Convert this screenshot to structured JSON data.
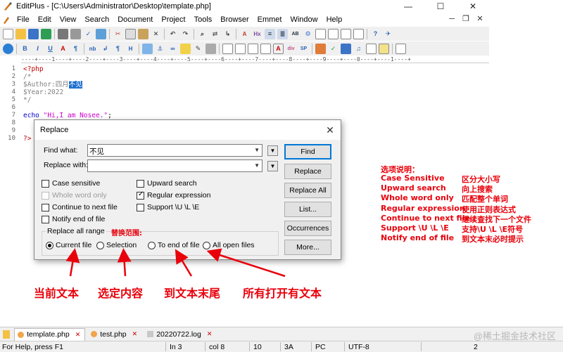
{
  "window": {
    "title": "EditPlus - [C:\\Users\\Administrator\\Desktop\\template.php]",
    "minimize": "—",
    "maximize": "☐",
    "close": "✕"
  },
  "menu": {
    "items": [
      "File",
      "Edit",
      "View",
      "Search",
      "Document",
      "Project",
      "Tools",
      "Browser",
      "Emmet",
      "Window",
      "Help"
    ],
    "right": [
      "─",
      "❐",
      "✕"
    ]
  },
  "ruler": "----+----1----+----2----+----3----+----4----+----5----+----6----+----7----+----8----+----9----+----0----+----1----+",
  "editor": {
    "line_numbers": [
      "1",
      "2",
      "3",
      "4",
      "5",
      "6",
      "7",
      "8",
      "9",
      "10"
    ],
    "lines": {
      "l1": "<?php",
      "l2": "/*",
      "l3_a": "$Author:四月",
      "l3_sel": "不见",
      "l4": "$Year:2022",
      "l5": "*/",
      "l7_a": "echo ",
      "l7_str": "\"Hi,I am Nosee.\"",
      "l7_end": ";",
      "l10": "?>"
    }
  },
  "dialog": {
    "title": "Replace",
    "close": "✕",
    "find_label": "Find what:",
    "find_value": "不见",
    "replace_label": "Replace with:",
    "replace_value": "",
    "options": {
      "case_sensitive": "Case sensitive",
      "whole_word": "Whole word only",
      "continue_next": "Continue to next file",
      "notify_end": "Notify end of file",
      "upward": "Upward search",
      "regex": "Regular expression",
      "support_ule": "Support \\U \\L \\E"
    },
    "range_label": "Replace all range",
    "ranges": [
      "Current file",
      "Selection",
      "To end of file",
      "All open files"
    ],
    "buttons": [
      "Find",
      "Replace",
      "Replace All",
      "List...",
      "Occurrences",
      "More..."
    ]
  },
  "annotations": {
    "range_cn": "替换范围:",
    "current_file": "当前文本",
    "selection": "选定内容",
    "to_end": "到文本末尾",
    "all_open": "所有打开有文本",
    "options_title": "选项说明：",
    "options": [
      {
        "en": "Case Sensitive",
        "cn": "区分大小写"
      },
      {
        "en": "Upward search",
        "cn": "向上搜索"
      },
      {
        "en": "Whole word only",
        "cn": "匹配整个单词"
      },
      {
        "en": "Regular expression",
        "cn": "使用正则表达式"
      },
      {
        "en": "Continue to next file",
        "cn": "继续查找下一个文件"
      },
      {
        "en": "Support \\U \\L \\E",
        "cn": "支持\\U \\L \\E符号"
      },
      {
        "en": "Notify end of file",
        "cn": "到文本末必时提示"
      }
    ],
    "color": "#e8000b"
  },
  "tabs": [
    {
      "label": "template.php",
      "active": true
    },
    {
      "label": "test.php",
      "active": false
    },
    {
      "label": "20220722.log",
      "active": false
    }
  ],
  "watermark": "@稀土掘金技术社区",
  "status": {
    "help": "For Help, press F1",
    "ln": "In 3",
    "col": "col 8",
    "n10": "10",
    "hex": "3A",
    "pc": "PC",
    "enc": "UTF-8",
    "num": "2"
  }
}
